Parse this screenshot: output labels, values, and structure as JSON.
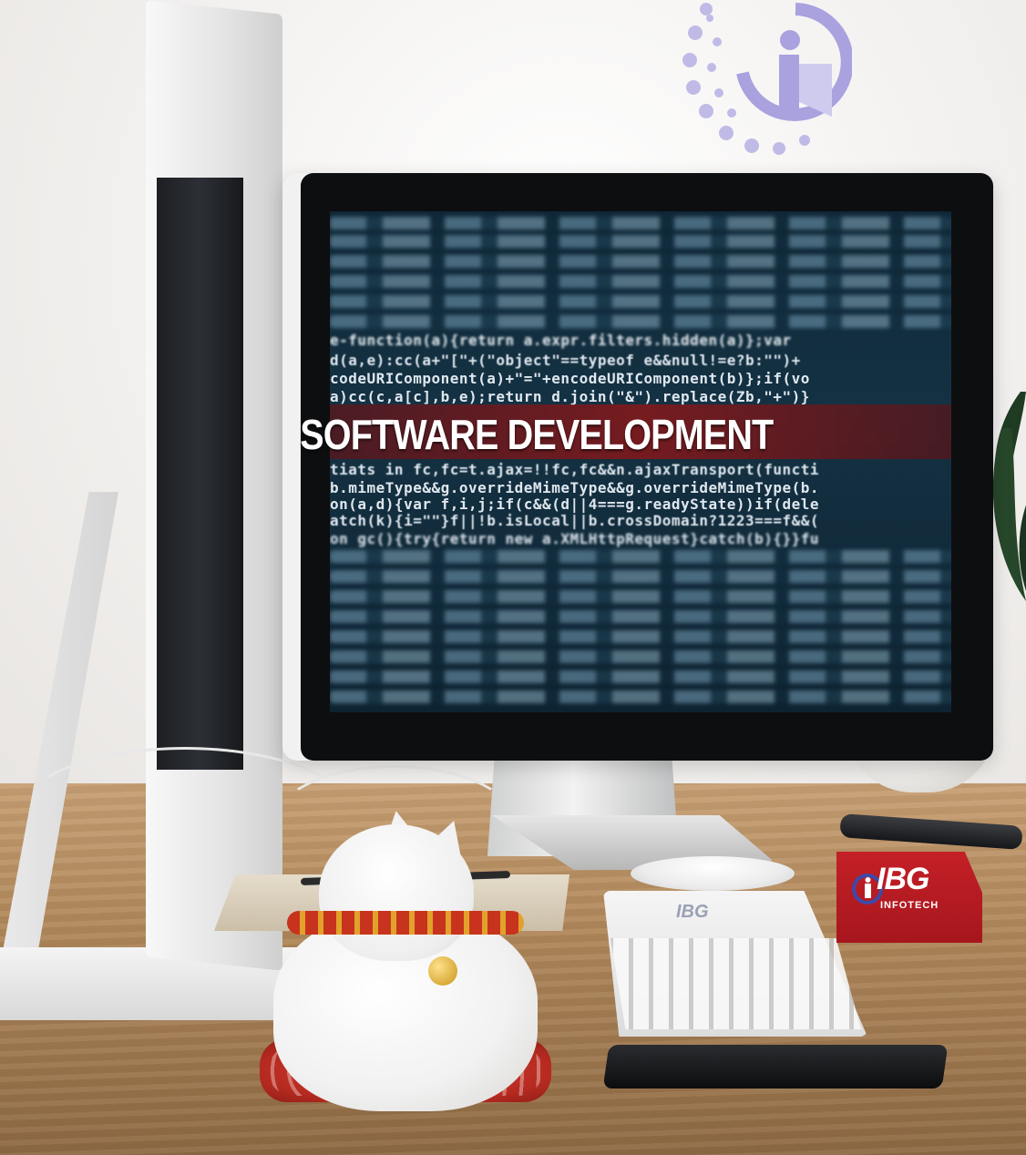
{
  "screen": {
    "headline": "SOFTWARE DEVELOPMENT",
    "code_lines": [
      "e-function(a){return a.expr.filters.hidden(a)};var",
      "d(a,e):cc(a+\"[\"+(\"object\"==typeof e&&null!=e?b:\"\")+",
      "codeURIComponent(a)+\"=\"+encodeURIComponent(b)};if(vo",
      "a)cc(c,a[c],b,e);return d.join(\"&\").replace(Zb,\"+\")}",
      "tiats in fc,fc=t.ajax=!!fc,fc&&n.ajaxTransport(functi",
      "b.mimeType&&g.overrideMimeType&&g.overrideMimeType(b.",
      "on(a,d){var f,i,j;if(c&&(d||4===g.readyState))if(dele",
      "atch(k){i=\"\"}f||!b.isLocal||b.crossDomain?1223===f&&(",
      "on gc(){try{return new a.XMLHttpRequest}catch(b){}}fu"
    ]
  },
  "branding": {
    "keyboard_logo": "IBG",
    "card_logo": "IBG",
    "card_subtitle": "INFOTECH",
    "brand_red": "#c42027",
    "logo_blue": "#a9a2de"
  }
}
